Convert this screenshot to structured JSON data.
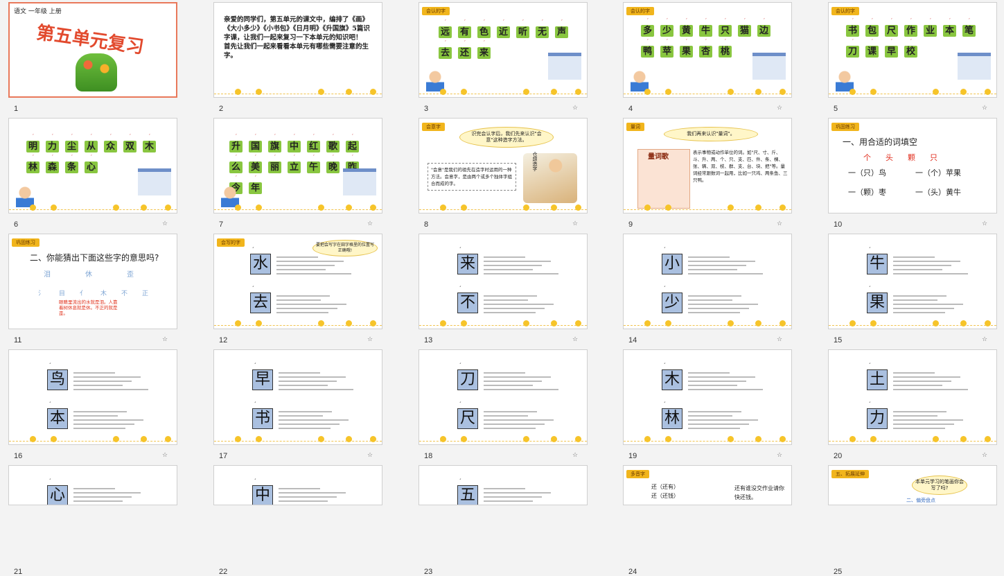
{
  "slides": [
    {
      "n": "1",
      "header": "语文    一年级    上册",
      "title": "第五单元复习"
    },
    {
      "n": "2",
      "text": "亲爱的同学们，第五单元的课文中，编排了《画》《大小多少》《小书包》《日月明》《升国旗》5篇识字课，让我们一起来复习一下本单元的知识吧！\n首先让我们一起来看看本单元有哪些需要注意的生字。"
    },
    {
      "n": "3",
      "tag": "会认的字",
      "chars": [
        "远",
        "有",
        "色",
        "近",
        "听",
        "无",
        "声",
        "去",
        "还",
        "来"
      ]
    },
    {
      "n": "4",
      "tag": "会认的字",
      "chars": [
        "多",
        "少",
        "黄",
        "牛",
        "只",
        "猫",
        "边",
        "鸭",
        "苹",
        "果",
        "杏",
        "桃"
      ]
    },
    {
      "n": "5",
      "tag": "会认的字",
      "chars": [
        "书",
        "包",
        "尺",
        "作",
        "业",
        "本",
        "笔",
        "刀",
        "课",
        "早",
        "校"
      ]
    },
    {
      "n": "6",
      "chars": [
        "明",
        "力",
        "尘",
        "从",
        "众",
        "双",
        "木",
        "林",
        "森",
        "条",
        "心"
      ]
    },
    {
      "n": "7",
      "chars": [
        "升",
        "国",
        "旗",
        "中",
        "红",
        "歌",
        "起",
        "么",
        "美",
        "丽",
        "立",
        "午",
        "晚",
        "昨",
        "今",
        "年"
      ]
    },
    {
      "n": "8",
      "tag": "会意字",
      "bubble": "识完会认字后，我们先来认识\"会意\"这种造字方法。",
      "note": "\"会意\"是我们的祖先在造字时运用的一种方法。会意字，是由两个或多个独体字组合而成的字。",
      "side": "仓颉造字"
    },
    {
      "n": "9",
      "tag": "量词",
      "bubble": "我们再来认识\"量词\"。",
      "poem": "量词歌",
      "text": "表示事物或动作单位的词。如\"尺、寸、斤、斗、升、两、个、只、支、匹、件、条、棵、张、辆、双、枝、群、支、台、块、把\"等。量词经常跟数词一起用，比如一只鸡、两条鱼、三只鸭。"
    },
    {
      "n": "10",
      "tag": "巩固练习",
      "title": "一、用合适的词填空",
      "options": [
        "个",
        "头",
        "颗",
        "只"
      ],
      "q1": "一（只）鸟",
      "q2": "一（个）苹果",
      "q3": "一（颗）枣",
      "q4": "一（头）黄牛"
    },
    {
      "n": "11",
      "tag": "巩固练习",
      "title": "二、你能猜出下面这些字的意思吗?",
      "words": [
        "泪",
        "休",
        "歪"
      ],
      "parts": [
        "氵",
        "目",
        "亻",
        "木",
        "不",
        "正"
      ],
      "note": "眼睛里流出的水就是泪。人靠着树休息就是休。不正的就是歪。"
    },
    {
      "n": "12",
      "tag": "会写的字",
      "bubble": "要把会写字在田字格里的位置写正确哦!",
      "chars": [
        "水",
        "去"
      ]
    },
    {
      "n": "13",
      "chars": [
        "来",
        "不"
      ]
    },
    {
      "n": "14",
      "chars": [
        "小",
        "少"
      ]
    },
    {
      "n": "15",
      "chars": [
        "牛",
        "果"
      ]
    },
    {
      "n": "16",
      "chars": [
        "鸟",
        "本"
      ]
    },
    {
      "n": "17",
      "chars": [
        "早",
        "书"
      ]
    },
    {
      "n": "18",
      "chars": [
        "刀",
        "尺"
      ]
    },
    {
      "n": "19",
      "chars": [
        "木",
        "林"
      ]
    },
    {
      "n": "20",
      "chars": [
        "土",
        "力"
      ]
    },
    {
      "n": "21",
      "chars": [
        "心"
      ]
    },
    {
      "n": "22",
      "chars": [
        "中"
      ]
    },
    {
      "n": "23",
      "chars": [
        "五"
      ]
    },
    {
      "n": "24",
      "tag": "多音字",
      "text": "还（还有）\n还（还钱）",
      "side": "还有谁没交作业请你快还钱。"
    },
    {
      "n": "25",
      "tag": "五、拓展延伸",
      "bubble": "本单元学习的笔画你会写了吗?",
      "title": "二、偏旁盘点"
    }
  ],
  "colors": {
    "selected_border": "#e9785a",
    "card_green": "#89c640",
    "card_blue": "#aac0e0",
    "tag_orange": "#f1b51c"
  }
}
